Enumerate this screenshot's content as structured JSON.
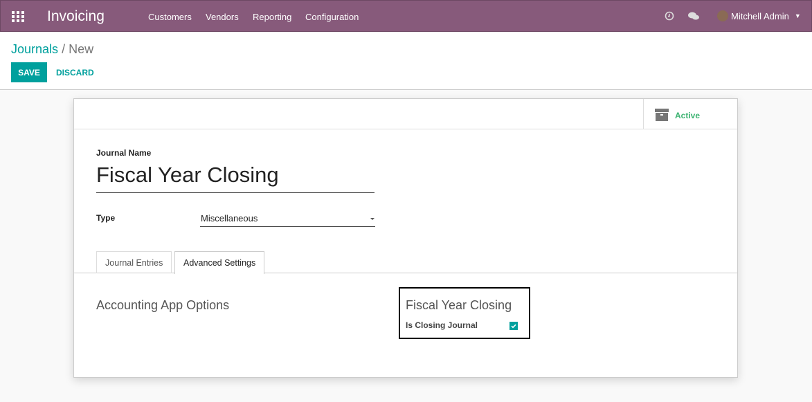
{
  "navbar": {
    "brand": "Invoicing",
    "menu": [
      "Customers",
      "Vendors",
      "Reporting",
      "Configuration"
    ],
    "user": "Mitchell Admin",
    "icons": [
      "clock-icon",
      "chat-icon"
    ]
  },
  "control": {
    "breadcrumb_parent": "Journals",
    "breadcrumb_current": "New",
    "save": "SAVE",
    "discard": "DISCARD"
  },
  "form": {
    "active_label": "Active",
    "journal_name_label": "Journal Name",
    "journal_name": "Fiscal Year Closing",
    "type_label": "Type",
    "type_value": "Miscellaneous",
    "tabs": [
      "Journal Entries",
      "Advanced Settings"
    ],
    "section_left": "Accounting App Options",
    "section_right": "Fiscal Year Closing",
    "closing_label": "Is Closing Journal",
    "closing_checked": true
  },
  "colors": {
    "brand": "#875a7b",
    "accent": "#00a09d",
    "active": "#3cb371"
  }
}
